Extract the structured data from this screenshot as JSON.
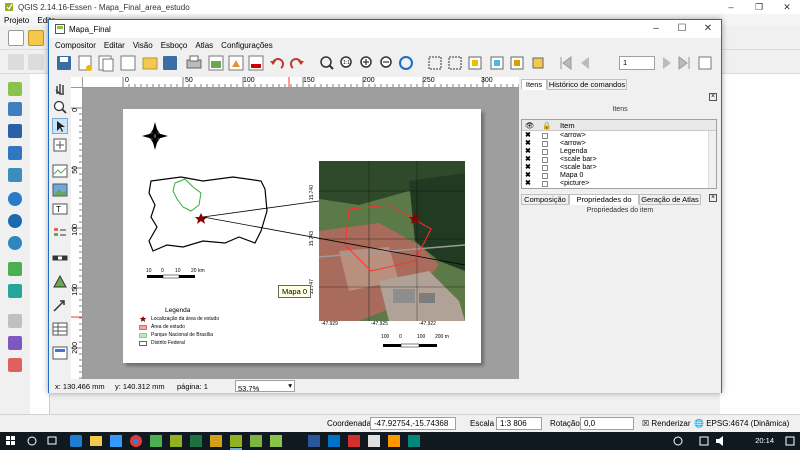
{
  "qgis": {
    "title": "QGIS 2.14.16-Essen - Mapa_Final_area_estudo",
    "menu": [
      "Projeto",
      "Edita"
    ],
    "status": {
      "coord_label": "Coordenada",
      "coord_value": "-47.92754,-15.74368",
      "scale_label": "Escala",
      "scale_value": "1:3 806",
      "rotation_label": "Rotação",
      "rotation_value": "0,0",
      "render_label": "Renderizar",
      "crs": "EPSG:4674 (Dinâmica)"
    }
  },
  "composer": {
    "title": "Mapa_Final",
    "menu": [
      "Compositor",
      "Editar",
      "Visão",
      "Esboço",
      "Atlas",
      "Configurações"
    ],
    "page_number": "1",
    "ruler_h": [
      "0",
      "50",
      "100",
      "150",
      "200",
      "250",
      "300"
    ],
    "ruler_v": [
      "0",
      "50",
      "100",
      "150",
      "200"
    ],
    "status": {
      "x": "x: 130.466 mm",
      "y": "y: 140.312 mm",
      "page": "página: 1",
      "zoom": "53.7%"
    },
    "tooltip": "Mapa 0",
    "tabs_top": [
      "Itens",
      "Histórico de comandos"
    ],
    "items_dock_title": "Itens",
    "items_header": "Item",
    "items": [
      "<arrow>",
      "<arrow>",
      "Legenda",
      "<scale bar>",
      "<scale bar>",
      "Mapa 0",
      "<picture>"
    ],
    "tabs_bottom": [
      "Composição",
      "Propriedades do item",
      "Geração de Atlas"
    ],
    "props_dock_title": "Propriedades do item"
  },
  "map_layout": {
    "scale_small": [
      "10",
      "0",
      "10",
      "20 km"
    ],
    "legend_title": "Legenda",
    "legend_items": [
      {
        "label": "Localização da área de estudo",
        "color": "#8b0000"
      },
      {
        "label": "Área de estudo",
        "color": "#f4a3a3"
      },
      {
        "label": "Parque Nacional de Brasília",
        "color": "#7fd37f"
      },
      {
        "label": "Distrito Federal",
        "color": "#ffffff"
      }
    ],
    "zoom_coords_x": [
      "-47.929",
      "-47.925",
      "-47.922"
    ],
    "zoom_coords_y": [
      "15.740",
      "15.743",
      "15.747"
    ],
    "scale_large": [
      "100",
      "0",
      "100",
      "200 m"
    ]
  },
  "taskbar": {
    "time": "20:14"
  },
  "colors": {
    "accent": "#1e6cc8",
    "taskbar": "#101820",
    "north_arrow": "#000000"
  }
}
